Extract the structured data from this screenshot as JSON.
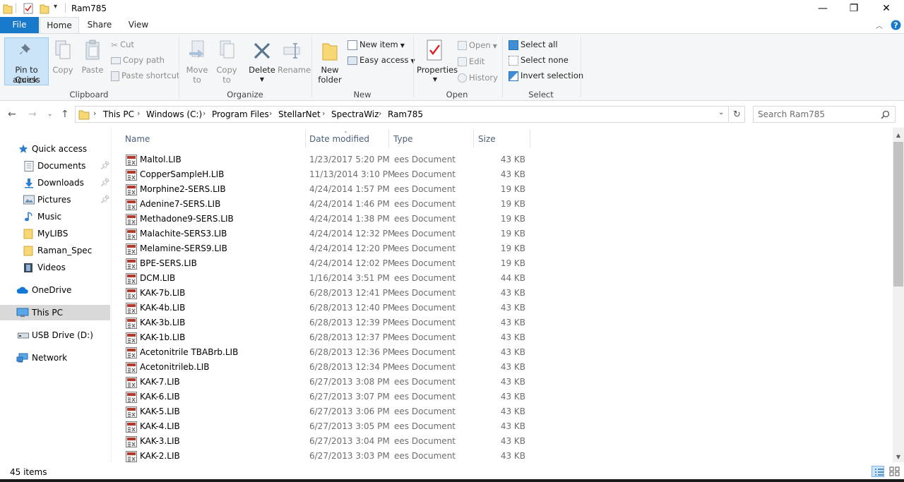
{
  "window": {
    "title": "Ram785",
    "minimize": "—",
    "restore": "❐",
    "close": "✕"
  },
  "tabs": {
    "file": "File",
    "home": "Home",
    "share": "Share",
    "view": "View"
  },
  "ribbon": {
    "clipboard": {
      "label": "Clipboard",
      "pin_line1": "Pin to Quick",
      "pin_line2": "access",
      "copy": "Copy",
      "paste": "Paste",
      "cut": "Cut",
      "copy_path": "Copy path",
      "paste_shortcut": "Paste shortcut"
    },
    "organize": {
      "label": "Organize",
      "move_to_line1": "Move",
      "move_to_line2": "to",
      "copy_to_line1": "Copy",
      "copy_to_line2": "to",
      "delete": "Delete",
      "rename": "Rename"
    },
    "new": {
      "label": "New",
      "new_folder_line1": "New",
      "new_folder_line2": "folder",
      "new_item": "New item",
      "easy_access": "Easy access"
    },
    "open": {
      "label": "Open",
      "properties": "Properties",
      "open": "Open",
      "edit": "Edit",
      "history": "History"
    },
    "select": {
      "label": "Select",
      "select_all": "Select all",
      "select_none": "Select none",
      "invert_selection": "Invert selection"
    }
  },
  "address": {
    "crumbs": [
      "This PC",
      "Windows (C:)",
      "Program Files",
      "StellarNet",
      "SpectraWiz",
      "Ram785"
    ],
    "search_placeholder": "Search Ram785"
  },
  "navpane": {
    "quick_access": "Quick access",
    "documents": "Documents",
    "downloads": "Downloads",
    "pictures": "Pictures",
    "music": "Music",
    "mylibs": "MyLIBS",
    "raman_spec": "Raman_Spec",
    "videos": "Videos",
    "onedrive": "OneDrive",
    "this_pc": "This PC",
    "usb_drive": "USB Drive (D:)",
    "network": "Network"
  },
  "filelist": {
    "columns": {
      "name": "Name",
      "date": "Date modified",
      "type": "Type",
      "size": "Size"
    },
    "rows": [
      {
        "name": "Maltol.LIB",
        "date": "1/23/2017 5:20 PM",
        "type": "ees Document",
        "size": "43 KB"
      },
      {
        "name": "CopperSampleH.LIB",
        "date": "11/13/2014 3:10 PM",
        "type": "ees Document",
        "size": "43 KB"
      },
      {
        "name": "Morphine2-SERS.LIB",
        "date": "4/24/2014 1:57 PM",
        "type": "ees Document",
        "size": "19 KB"
      },
      {
        "name": "Adenine7-SERS.LIB",
        "date": "4/24/2014 1:46 PM",
        "type": "ees Document",
        "size": "19 KB"
      },
      {
        "name": "Methadone9-SERS.LIB",
        "date": "4/24/2014 1:38 PM",
        "type": "ees Document",
        "size": "19 KB"
      },
      {
        "name": "Malachite-SERS3.LIB",
        "date": "4/24/2014 12:32 PM",
        "type": "ees Document",
        "size": "19 KB"
      },
      {
        "name": "Melamine-SERS9.LIB",
        "date": "4/24/2014 12:20 PM",
        "type": "ees Document",
        "size": "19 KB"
      },
      {
        "name": "BPE-SERS.LIB",
        "date": "4/24/2014 12:02 PM",
        "type": "ees Document",
        "size": "19 KB"
      },
      {
        "name": "DCM.LIB",
        "date": "1/16/2014 3:51 PM",
        "type": "ees Document",
        "size": "44 KB"
      },
      {
        "name": "KAK-7b.LIB",
        "date": "6/28/2013 12:41 PM",
        "type": "ees Document",
        "size": "43 KB"
      },
      {
        "name": "KAK-4b.LIB",
        "date": "6/28/2013 12:40 PM",
        "type": "ees Document",
        "size": "43 KB"
      },
      {
        "name": "KAK-3b.LIB",
        "date": "6/28/2013 12:39 PM",
        "type": "ees Document",
        "size": "43 KB"
      },
      {
        "name": "KAK-1b.LIB",
        "date": "6/28/2013 12:37 PM",
        "type": "ees Document",
        "size": "43 KB"
      },
      {
        "name": "Acetonitrile TBABrb.LIB",
        "date": "6/28/2013 12:36 PM",
        "type": "ees Document",
        "size": "43 KB"
      },
      {
        "name": "Acetonitrileb.LIB",
        "date": "6/28/2013 12:34 PM",
        "type": "ees Document",
        "size": "43 KB"
      },
      {
        "name": "KAK-7.LIB",
        "date": "6/27/2013 3:08 PM",
        "type": "ees Document",
        "size": "43 KB"
      },
      {
        "name": "KAK-6.LIB",
        "date": "6/27/2013 3:07 PM",
        "type": "ees Document",
        "size": "43 KB"
      },
      {
        "name": "KAK-5.LIB",
        "date": "6/27/2013 3:06 PM",
        "type": "ees Document",
        "size": "43 KB"
      },
      {
        "name": "KAK-4.LIB",
        "date": "6/27/2013 3:05 PM",
        "type": "ees Document",
        "size": "43 KB"
      },
      {
        "name": "KAK-3.LIB",
        "date": "6/27/2013 3:04 PM",
        "type": "ees Document",
        "size": "43 KB"
      },
      {
        "name": "KAK-2.LIB",
        "date": "6/27/2013 3:03 PM",
        "type": "ees Document",
        "size": "43 KB"
      }
    ]
  },
  "status": {
    "item_count": "45 items"
  },
  "colors": {
    "file_tab": "#1979ca",
    "ribbon_bg": "#f5f6f7",
    "selection": "#cce4f7",
    "header_text": "#4c607a",
    "folder": "#f8d775",
    "help": "#1979ca"
  }
}
